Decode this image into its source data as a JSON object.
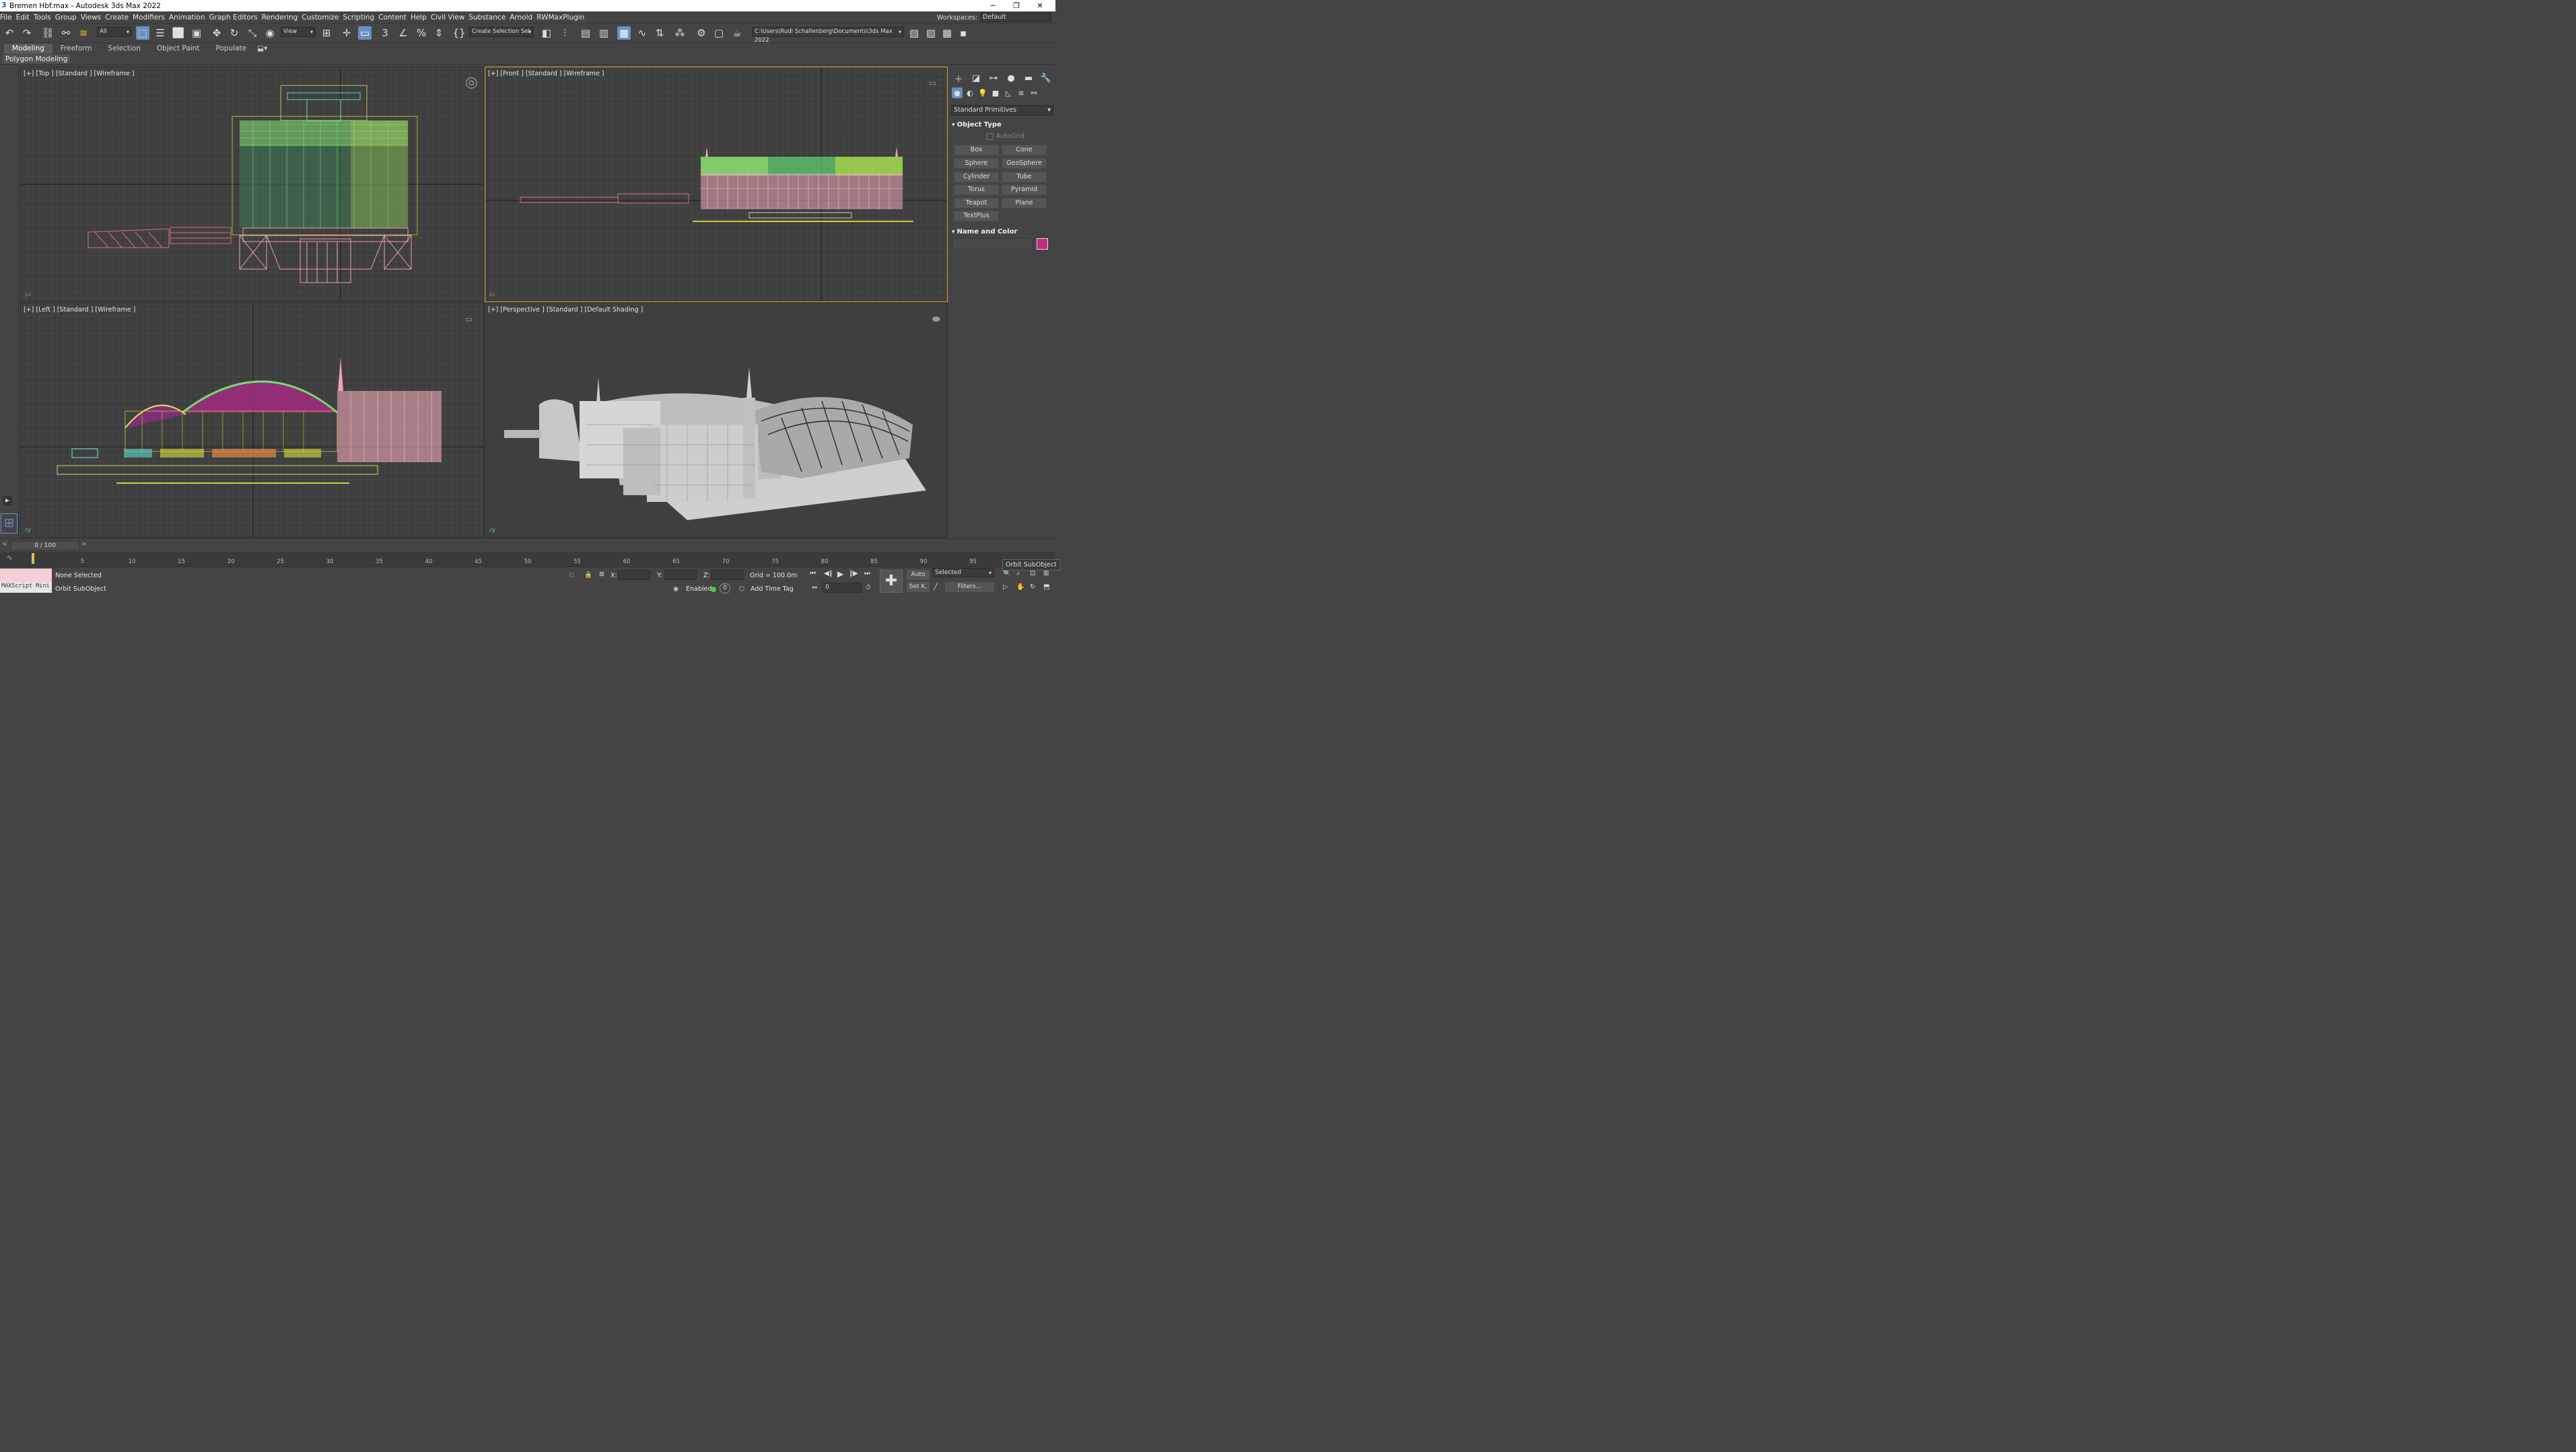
{
  "window": {
    "title": "Bremen Hbf.max - Autodesk 3ds Max 2022"
  },
  "menu": [
    "File",
    "Edit",
    "Tools",
    "Group",
    "Views",
    "Create",
    "Modifiers",
    "Animation",
    "Graph Editors",
    "Rendering",
    "Customize",
    "Scripting",
    "Content",
    "Help",
    "Civil View",
    "Substance",
    "Arnold",
    "RWMaxPlugin"
  ],
  "workspace": {
    "label": "Workspaces:",
    "value": "Default"
  },
  "toolbar": {
    "filter": "All",
    "ref_coord": "View",
    "selection_set": "Create Selection Set",
    "project_path": "C:\\Users\\Rudi Schallenberg\\Documents\\3ds Max 2022"
  },
  "ribbon": {
    "tabs": [
      "Modeling",
      "Freeform",
      "Selection",
      "Object Paint",
      "Populate"
    ],
    "active_panel": "Polygon Modeling"
  },
  "viewports": {
    "top": "[+] [Top ] [Standard ] [Wireframe ]",
    "front": "[+] [Front ] [Standard ] [Wireframe ]",
    "left": "[+] [Left ] [Standard ] [Wireframe ]",
    "perspective": "[+] [Perspective ] [Standard ] [Default Shading ]"
  },
  "command_panel": {
    "category": "Standard Primitives",
    "object_type_title": "Object Type",
    "autogrid": "AutoGrid",
    "buttons": [
      "Box",
      "Cone",
      "Sphere",
      "GeoSphere",
      "Cylinder",
      "Tube",
      "Torus",
      "Pyramid",
      "Teapot",
      "Plane",
      "TextPlus"
    ],
    "name_color_title": "Name and Color",
    "color": "#c22a7e"
  },
  "timeline": {
    "frame": "0 / 100",
    "ticks": [
      "0",
      "5",
      "10",
      "15",
      "20",
      "25",
      "30",
      "35",
      "40",
      "45",
      "50",
      "55",
      "60",
      "65",
      "70",
      "75",
      "80",
      "85",
      "90",
      "95"
    ]
  },
  "status": {
    "maxscript": "MAXScript Mini",
    "selection": "None Selected",
    "prompt": "Orbit SubObject",
    "x_label": "X:",
    "y_label": "Y:",
    "z_label": "Z:",
    "grid": "Grid = 100.0m",
    "enabled_label": "Enabled:",
    "enabled_value": "0",
    "add_time_tag": "Add Time Tag",
    "auto_key": "Auto",
    "set_key": "Set K.",
    "key_filter": "Selected",
    "filters": "Filters...",
    "current_frame": "0",
    "tooltip": "Orbit SubObject"
  }
}
